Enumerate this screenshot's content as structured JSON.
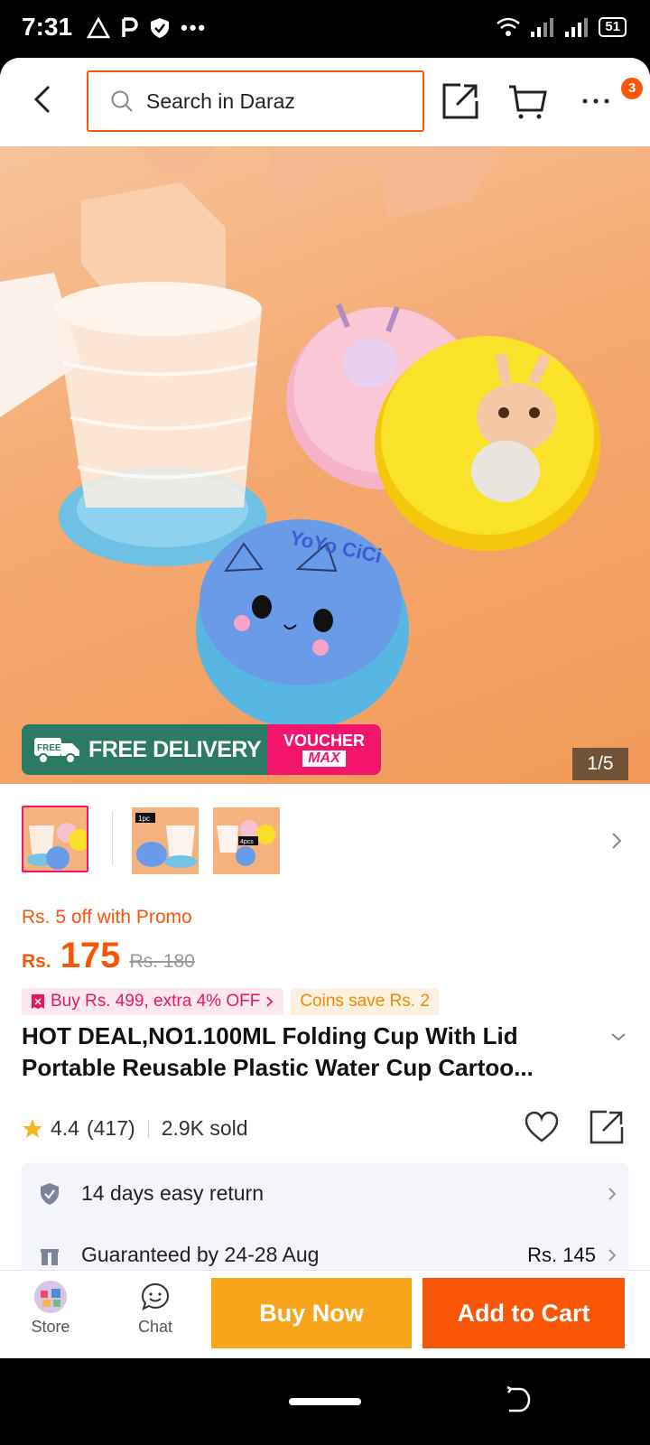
{
  "status_bar": {
    "time": "7:31",
    "battery": "51"
  },
  "topbar": {
    "search_placeholder": "Search in Daraz",
    "cart_badge": "3"
  },
  "hero": {
    "free_delivery": "FREE DELIVERY",
    "free_tag": "FREE",
    "voucher_line1": "VOUCHER",
    "voucher_line2": "MAX",
    "counter": "1/5",
    "product_print": "YoYo CiCi",
    "thumb_2_label": "1pc",
    "thumb_3_label": "4pcs"
  },
  "product": {
    "promo": "Rs. 5 off with Promo",
    "price_currency": "Rs.",
    "price": "175",
    "old_price": "Rs. 180",
    "tag_offer": "Buy Rs. 499, extra 4% OFF",
    "tag_coins": "Coins save Rs. 2",
    "title": "HOT DEAL,NO1.100ML Folding Cup With Lid Portable Reusable Plastic Water Cup Cartoo...",
    "rating": "4.4",
    "reviews": "(417)",
    "sold": "2.9K sold"
  },
  "services": [
    {
      "label": "14 days easy return",
      "price": ""
    },
    {
      "label": "Guaranteed by 24-28 Aug",
      "price": "Rs. 145"
    }
  ],
  "actionbar": {
    "store": "Store",
    "chat": "Chat",
    "buy_now": "Buy Now",
    "add_to_cart": "Add to Cart"
  },
  "colors": {
    "brand": "#f85606",
    "buy": "#f9a51b",
    "voucher": "#f2156b",
    "free_delivery": "#2d7a64"
  }
}
